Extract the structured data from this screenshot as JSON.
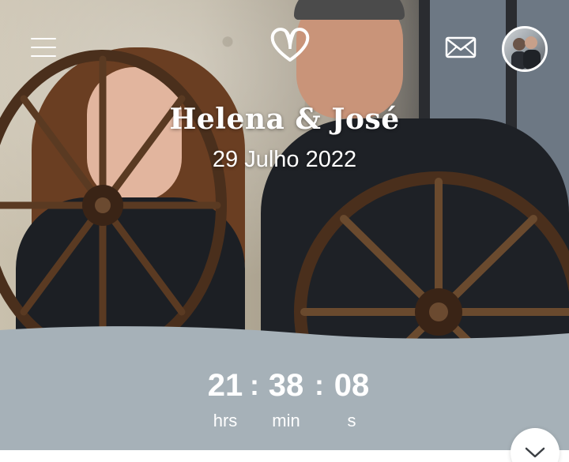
{
  "header": {
    "menu_icon": "hamburger-menu-icon",
    "logo_icon": "heart-logo-icon",
    "mail_icon": "envelope-icon",
    "avatar_icon": "couple-photo-avatar"
  },
  "hero": {
    "names": "Helena & José",
    "date": "29 Julho 2022"
  },
  "countdown": {
    "hours": {
      "value": "21",
      "label": "hrs"
    },
    "minutes": {
      "value": "38",
      "label": "min"
    },
    "seconds": {
      "value": "08",
      "label": "s"
    },
    "separator": ":"
  },
  "scroll": {
    "icon": "chevron-down-icon"
  },
  "colors": {
    "panel": "#a6b1b8",
    "text": "#ffffff",
    "accent_white": "#ffffff"
  }
}
